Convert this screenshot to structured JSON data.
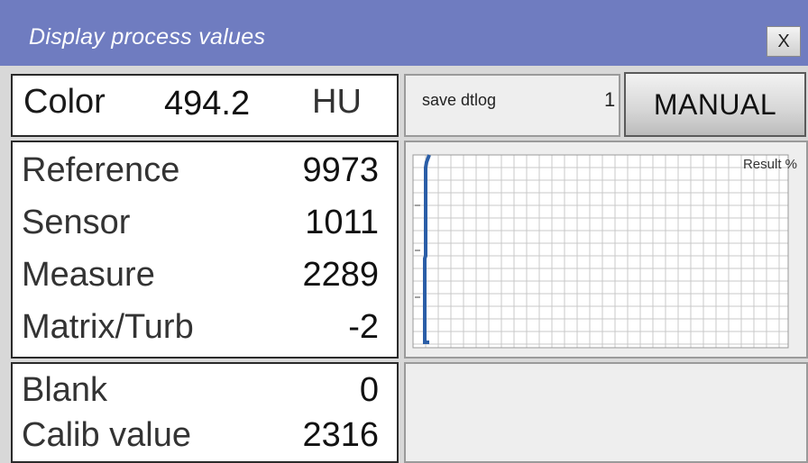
{
  "window": {
    "title": "Display process values",
    "close_label": "X"
  },
  "color_panel": {
    "label": "Color",
    "value": "494.2",
    "unit": "HU"
  },
  "save_panel": {
    "label": "save dtlog",
    "count": "1"
  },
  "mode_button": {
    "label": "MANUAL"
  },
  "process_values": [
    {
      "label": "Reference",
      "value": "9973"
    },
    {
      "label": "Sensor",
      "value": "1011"
    },
    {
      "label": "Measure",
      "value": "2289"
    },
    {
      "label": "Matrix/Turb",
      "value": "-2"
    }
  ],
  "calibration_values": [
    {
      "label": "Blank",
      "value": "0"
    },
    {
      "label": "Calib value",
      "value": "2316"
    }
  ],
  "chart_data": {
    "type": "line",
    "legend": "Result %",
    "grid": true,
    "line_color": "#2b5ea7"
  }
}
